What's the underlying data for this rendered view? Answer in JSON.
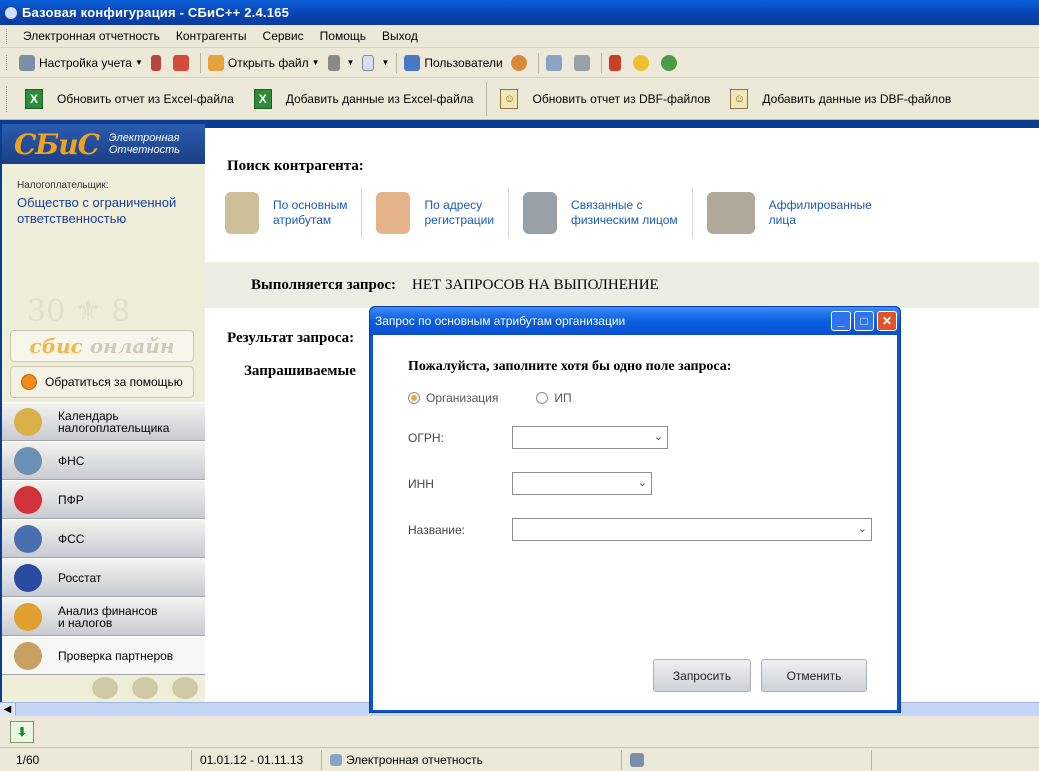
{
  "window": {
    "title": "Базовая конфигурация - СБиС++ 2.4.165"
  },
  "menu": [
    "Электронная отчетность",
    "Контрагенты",
    "Сервис",
    "Помощь",
    "Выход"
  ],
  "toolbar": {
    "settings_label": "Настройка учета",
    "open_file_label": "Открыть файл",
    "users_label": "Пользователи"
  },
  "toolbar2": {
    "update_excel": "Обновить отчет из Excel-файла",
    "add_excel": "Добавить данные из Excel-файла",
    "update_dbf": "Обновить отчет из DBF-файлов",
    "add_dbf": "Добавить данные из DBF-файлов"
  },
  "sidebar": {
    "logo": "СБиС",
    "logo_sub_1": "Электронная",
    "logo_sub_2": "Отчетность",
    "payer_label": "Налогоплательщик:",
    "payer_name_1": "Общество с ограниченной",
    "payer_name_2": "ответственностью",
    "online_a": "сбис",
    "online_b": "онлайн",
    "help_label": "Обратиться за помощью",
    "nav": [
      {
        "label_1": "Календарь",
        "label_2": "налогоплательщика",
        "color": "#d9b34a"
      },
      {
        "label_1": "ФНС",
        "label_2": "",
        "color": "#6b8fb5"
      },
      {
        "label_1": "ПФР",
        "label_2": "",
        "color": "#d2323a"
      },
      {
        "label_1": "ФСС",
        "label_2": "",
        "color": "#4a6fb0"
      },
      {
        "label_1": "Росстат",
        "label_2": "",
        "color": "#2a4aa0"
      },
      {
        "label_1": "Анализ финансов",
        "label_2": "и налогов",
        "color": "#e0a030"
      },
      {
        "label_1": "Проверка партнеров",
        "label_2": "",
        "color": "#c8a060"
      }
    ]
  },
  "content": {
    "search_title": "Поиск контрагента:",
    "links": [
      {
        "line1": "По основным",
        "line2": "атрибутам"
      },
      {
        "line1": "По адресу",
        "line2": "регистрации"
      },
      {
        "line1": "Связанные с",
        "line2": "физическим лицом"
      },
      {
        "line1": "Аффилированные",
        "line2": "лица"
      }
    ],
    "status_label": "Выполняется запрос:",
    "status_value": "НЕТ ЗАПРОСОВ НА ВЫПОЛНЕНИЕ",
    "result_label": "Результат запроса:",
    "requested_label": "Запрашиваемые"
  },
  "dialog": {
    "title": "Запрос по основным атрибутам организации",
    "heading": "Пожалуйста, заполните хотя бы одно поле запроса:",
    "radio_org": "Организация",
    "radio_ip": "ИП",
    "ogrn_label": "ОГРН:",
    "inn_label": "ИНН",
    "name_label": "Название:",
    "ogrn_value": "",
    "inn_value": "",
    "name_value": "",
    "submit_label": "Запросить",
    "cancel_label": "Отменить"
  },
  "statusbar": {
    "page": "1/60",
    "period": "01.01.12 - 01.11.13",
    "module": "Электронная отчетность"
  }
}
